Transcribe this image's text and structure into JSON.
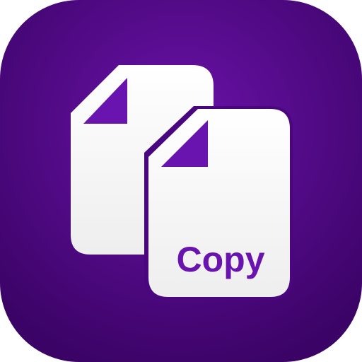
{
  "app_icon": {
    "caption": "Copy",
    "icons": {
      "back_document": "document-icon",
      "front_document": "document-icon"
    },
    "colors": {
      "background_center": "#6a12a8",
      "background_edge": "#3b0366",
      "document_fill": "#f7f7f9",
      "accent": "#6a14b0"
    }
  }
}
